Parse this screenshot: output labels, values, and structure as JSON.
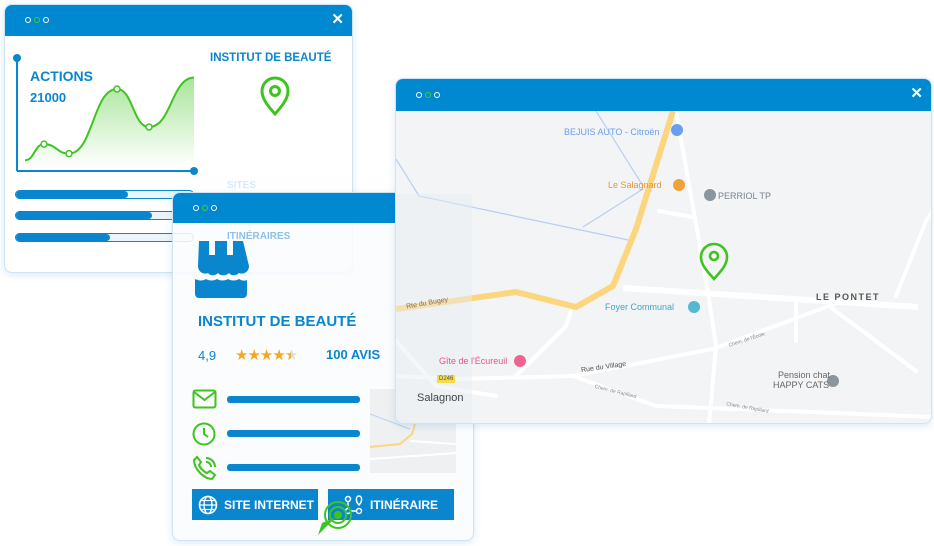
{
  "stats_window": {
    "title_dots": [
      "dot",
      "dot-active",
      "dot"
    ],
    "close_icon": "close-icon",
    "metric_label": "ACTIONS",
    "metric_value": "21000",
    "business_name": "INSTITUT DE BEAUTÉ",
    "location_icon": "map-pin-icon",
    "sparkline_values": [
      5,
      22,
      12,
      80,
      40,
      92
    ],
    "progress_bars": [
      {
        "label": "SITES",
        "fraction": 0.63
      },
      {
        "label": "",
        "fraction": 0.77
      },
      {
        "label": "ITINÉRAIRES",
        "fraction": 0.53
      }
    ]
  },
  "business_card": {
    "icon": "storefront-icon",
    "name": "INSTITUT DE BEAUTÉ",
    "rating": "4,9",
    "stars": 4.5,
    "reviews": "100 AVIS",
    "contacts": [
      "mail-icon",
      "clock-icon",
      "phone-icon"
    ],
    "buttons": {
      "website": "SITE INTERNET",
      "directions": "ITINÉRAIRE"
    }
  },
  "map_window": {
    "places": {
      "bejuis": "BEJUIS AUTO - Citroën",
      "salagnard": "Le Salagnard",
      "perriol": "PERRIOL TP",
      "pontet": "LE PONTET",
      "foyer": "Foyer Communal",
      "gite": "Gîte de l'Écureuil",
      "salagnon": "Salagnon",
      "pension1": "Pension chat",
      "pension2": "HAPPY CATS"
    },
    "roads": {
      "bugey": "Rte du Bugey",
      "village": "Rue du Village",
      "ecole": "Chem. de l'École",
      "rapillard1": "Chem. de Rapillard",
      "rapillard2": "Chem. de Rapillard",
      "d246": "D246"
    },
    "colors": {
      "accent": "#0088d1",
      "green": "#3ec41f",
      "road_major": "#fcd57f"
    }
  }
}
